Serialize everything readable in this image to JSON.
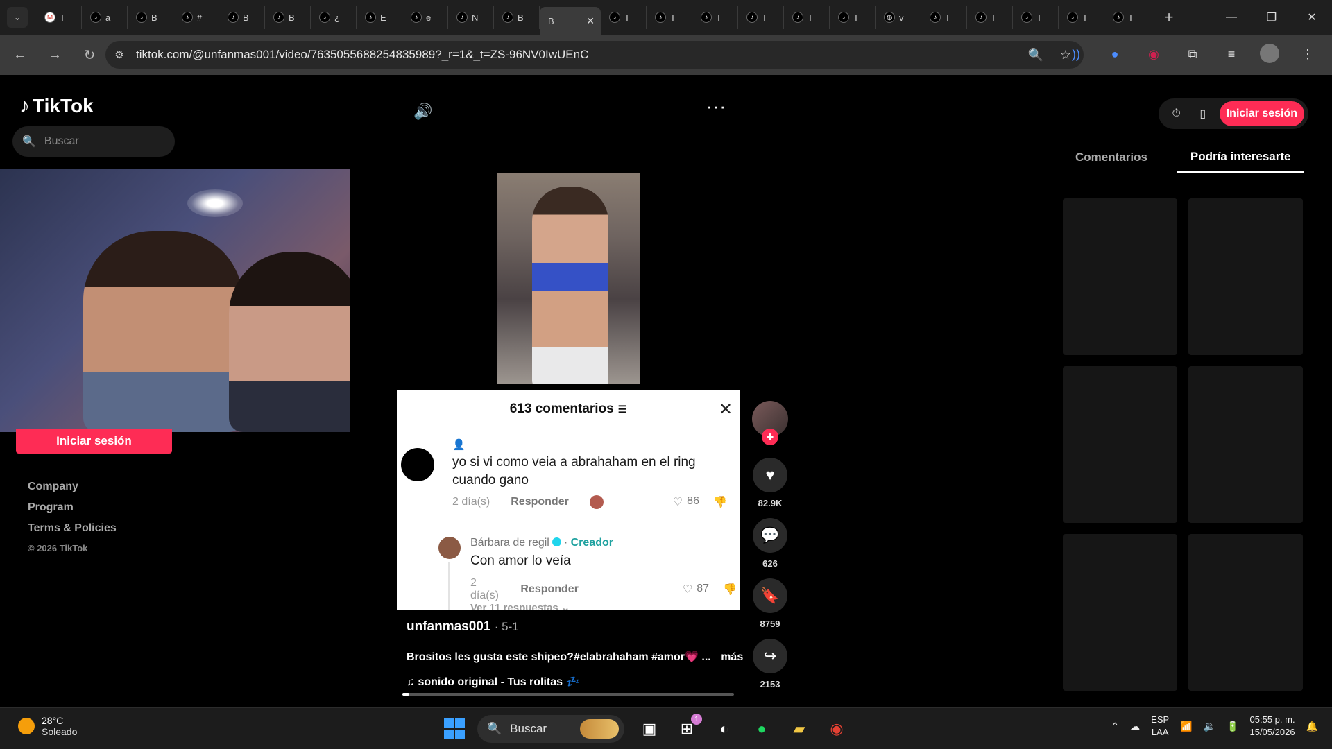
{
  "browser": {
    "tabs": [
      {
        "icon": "gmail-icon",
        "label": "T"
      },
      {
        "icon": "tiktok-icon",
        "label": "a"
      },
      {
        "icon": "tiktok-icon",
        "label": "B"
      },
      {
        "icon": "tiktok-icon",
        "label": "#"
      },
      {
        "icon": "tiktok-icon",
        "label": "B"
      },
      {
        "icon": "tiktok-icon",
        "label": "B"
      },
      {
        "icon": "tiktok-icon",
        "label": "¿"
      },
      {
        "icon": "tiktok-icon",
        "label": "E"
      },
      {
        "icon": "tiktok-icon",
        "label": "e"
      },
      {
        "icon": "tiktok-icon",
        "label": "N"
      },
      {
        "icon": "tiktok-icon",
        "label": "B"
      },
      {
        "icon": "none",
        "label": "B",
        "active": true
      },
      {
        "icon": "tiktok-icon",
        "label": "T"
      },
      {
        "icon": "tiktok-icon",
        "label": "T"
      },
      {
        "icon": "tiktok-icon",
        "label": "T"
      },
      {
        "icon": "tiktok-icon",
        "label": "T"
      },
      {
        "icon": "tiktok-icon",
        "label": "T"
      },
      {
        "icon": "tiktok-icon",
        "label": "T"
      },
      {
        "icon": "globe-icon",
        "label": "v"
      },
      {
        "icon": "tiktok-icon",
        "label": "T"
      },
      {
        "icon": "tiktok-icon",
        "label": "T"
      },
      {
        "icon": "tiktok-icon",
        "label": "T"
      },
      {
        "icon": "tiktok-icon",
        "label": "T"
      },
      {
        "icon": "tiktok-icon",
        "label": "T"
      }
    ],
    "url": "tiktok.com/@unfanmas001/video/7635055688254835989?_r=1&_t=ZS-96NV0IwUEnC"
  },
  "sidebar": {
    "logo": "TikTok",
    "search_placeholder": "Buscar",
    "login_button": "Iniciar sesión",
    "footer": [
      "Company",
      "Program",
      "Terms & Policies"
    ],
    "copyright": "© 2026 TikTok"
  },
  "comments": {
    "header": "613 comentarios",
    "items": [
      {
        "text": "yo si vi como veia a abrahaham en el ring cuando gano",
        "time": "2 día(s)",
        "reply": "Responder",
        "likes": "86"
      }
    ],
    "reply_item": {
      "author": "Bárbara de regil",
      "badge": "Creador",
      "text": "Con amor lo veía",
      "time": "2 día(s)",
      "reply": "Responder",
      "likes": "87"
    },
    "more_replies": "Ver 11 respuestas ⌄"
  },
  "video": {
    "author": "unfanmas001",
    "date": "5-1",
    "description": "Brositos les gusta este shipeo?#elabrahaham #amor💗 ...",
    "more": "más",
    "music": "sonido original - Tus rolitas 💤",
    "progress": 0.02
  },
  "actions": {
    "likes": "82.9K",
    "comments": "626",
    "saves": "8759",
    "shares": "2153"
  },
  "right_panel": {
    "login_button": "Iniciar sesión",
    "tab_comments": "Comentarios",
    "tab_suggested": "Podría interesarte"
  },
  "taskbar": {
    "temperature": "28°C",
    "weather": "Soleado",
    "search": "Buscar",
    "store_badge": "1",
    "lang1": "ESP",
    "lang2": "LAA",
    "time": "05:55 p. m.",
    "date": "15/05/2026"
  }
}
